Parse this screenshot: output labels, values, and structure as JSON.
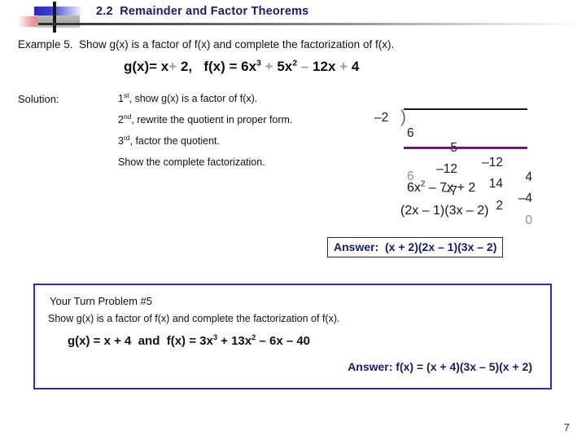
{
  "header": {
    "title": "2.2  Remainder and Factor Theorems"
  },
  "example": {
    "prompt": "Example 5.  Show g(x) is a factor of f(x) and complete the factorization of f(x).",
    "given_g": "g(x)= x",
    "given_g_plus": "+",
    "given_g_const": "2,",
    "given_f": "f(x) = 6x",
    "given_f_exp1": "3",
    "given_f_t2_sign": "+",
    "given_f_t2": "5x",
    "given_f_exp2": "2",
    "given_f_t3_sign": "–",
    "given_f_t3": "12x",
    "given_f_t4_sign": "+",
    "given_f_t4": "4"
  },
  "solution": {
    "label": "Solution:",
    "steps": [
      {
        "num": "1",
        "ord": "st",
        "text": ", show g(x) is a factor of f(x)."
      },
      {
        "num": "2",
        "ord": "nd",
        "text": ", rewrite the quotient in proper form."
      },
      {
        "num": "3",
        "ord": "rd",
        "text": ", factor the quotient."
      },
      {
        "num": "",
        "ord": "",
        "text": "Show the complete factorization."
      }
    ]
  },
  "synthetic_division": {
    "divisor": "–2",
    "dividend_coefficients": [
      "6",
      "5",
      "–12",
      "4"
    ],
    "carry_row": [
      "",
      "–12",
      "14",
      "–4"
    ],
    "result_row": [
      "6",
      "–7",
      "2",
      "0"
    ],
    "rule_color": "#6b1f6b"
  },
  "work": {
    "quotient": "6x",
    "quotient_exp": "2",
    "quotient_rest": " – 7x + 2",
    "factored": "(2x – 1)(3x – 2)"
  },
  "answer": {
    "label": "Answer:",
    "value": "(x + 2)(2x – 1)(3x – 2)"
  },
  "your_turn": {
    "title": "Your Turn Problem #5",
    "instruction": "Show g(x) is a factor of f(x) and complete the factorization of f(x).",
    "equation_g": "g(x) = x + 4  and  f(x) = 3x",
    "equation_exp1": "3",
    "equation_mid": " + 13x",
    "equation_exp2": "2",
    "equation_tail": " – 6x – 40",
    "answer": "Answer: f(x) = (x + 4)(3x – 5)(x + 2)"
  },
  "footer": {
    "page_number": "7"
  }
}
